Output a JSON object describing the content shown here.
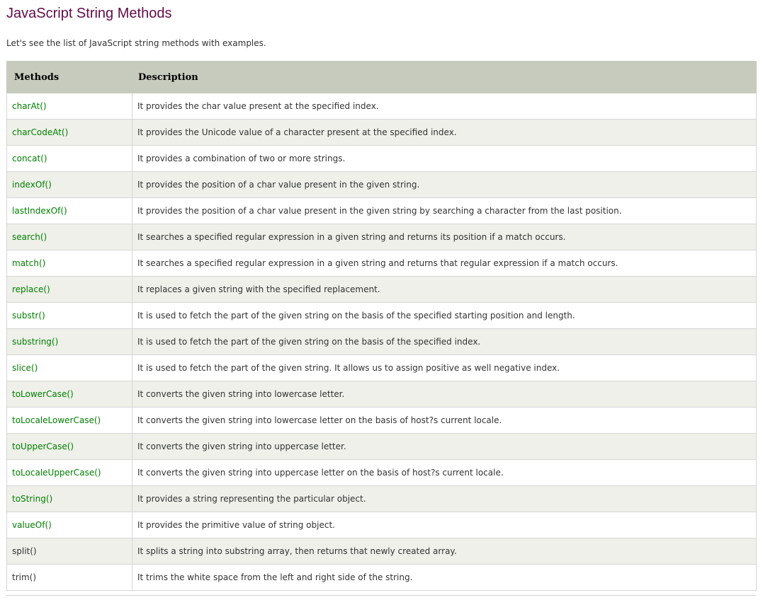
{
  "page": {
    "title": "JavaScript String Methods",
    "intro": "Let's see the list of JavaScript string methods with examples."
  },
  "table": {
    "headers": [
      "Methods",
      "Description"
    ],
    "rows": [
      {
        "method": "charAt()",
        "description": "It provides the char value present at the specified index.",
        "linked": true
      },
      {
        "method": "charCodeAt()",
        "description": "It provides the Unicode value of a character present at the specified index.",
        "linked": true
      },
      {
        "method": "concat()",
        "description": "It provides a combination of two or more strings.",
        "linked": true
      },
      {
        "method": "indexOf()",
        "description": "It provides the position of a char value present in the given string.",
        "linked": true
      },
      {
        "method": "lastIndexOf()",
        "description": "It provides the position of a char value present in the given string by searching a character from the last position.",
        "linked": true
      },
      {
        "method": "search()",
        "description": "It searches a specified regular expression in a given string and returns its position if a match occurs.",
        "linked": true
      },
      {
        "method": "match()",
        "description": "It searches a specified regular expression in a given string and returns that regular expression if a match occurs.",
        "linked": true
      },
      {
        "method": "replace()",
        "description": "It replaces a given string with the specified replacement.",
        "linked": true
      },
      {
        "method": "substr()",
        "description": "It is used to fetch the part of the given string on the basis of the specified starting position and length.",
        "linked": true
      },
      {
        "method": "substring()",
        "description": "It is used to fetch the part of the given string on the basis of the specified index.",
        "linked": true
      },
      {
        "method": "slice()",
        "description": "It is used to fetch the part of the given string. It allows us to assign positive as well negative index.",
        "linked": true
      },
      {
        "method": "toLowerCase()",
        "description": "It converts the given string into lowercase letter.",
        "linked": true
      },
      {
        "method": "toLocaleLowerCase()",
        "description": "It converts the given string into lowercase letter on the basis of host?s current locale.",
        "linked": true
      },
      {
        "method": "toUpperCase()",
        "description": "It converts the given string into uppercase letter.",
        "linked": true
      },
      {
        "method": "toLocaleUpperCase()",
        "description": "It converts the given string into uppercase letter on the basis of host?s current locale.",
        "linked": true
      },
      {
        "method": "toString()",
        "description": "It provides a string representing the particular object.",
        "linked": true
      },
      {
        "method": "valueOf()",
        "description": "It provides the primitive value of string object.",
        "linked": true
      },
      {
        "method": "split()",
        "description": "It splits a string into substring array, then returns that newly created array.",
        "linked": false
      },
      {
        "method": "trim()",
        "description": "It trims the white space from the left and right side of the string.",
        "linked": false
      }
    ]
  },
  "colors": {
    "title": "#610b4b",
    "link": "#008000",
    "header_bg": "#c7cbbd",
    "row_alt_bg": "#eef0e9"
  }
}
